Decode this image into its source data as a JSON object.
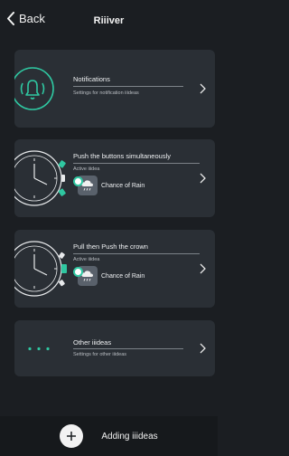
{
  "header": {
    "back_label": "Back",
    "title": "Riiiver"
  },
  "cards": [
    {
      "title": "Notifications",
      "subtitle": "Settings for notification iiideas"
    },
    {
      "title": "Push the buttons simultaneously",
      "subtitle": "Active iiidea",
      "iidea_name": "Chance of Rain"
    },
    {
      "title": "Pull then Push the crown",
      "subtitle": "Active iiidea",
      "iidea_name": "Chance of Rain"
    },
    {
      "title": "Other iiideas",
      "subtitle": "Settings for other iiideas"
    }
  ],
  "footer": {
    "add_label": "Adding iiideas"
  },
  "colors": {
    "accent": "#2fc7a1",
    "card_bg": "#2a2f35",
    "page_bg": "#1b1e22"
  }
}
